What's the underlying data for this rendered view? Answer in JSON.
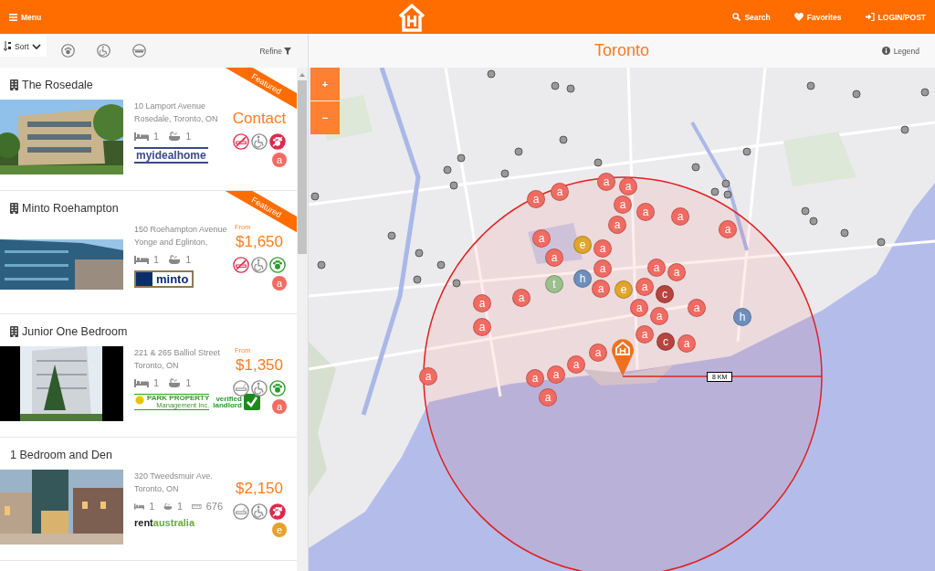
{
  "header": {
    "menu": "Menu",
    "nav": [
      "Search",
      "Favorites",
      "LOGIN/POST"
    ]
  },
  "toolbar": {
    "sort": "Sort",
    "refine": "Refine"
  },
  "listings": [
    {
      "title": "The Rosedale",
      "building_icon": true,
      "featured": true,
      "featured_label": "Featured",
      "address": [
        "10 Lamport Avenue",
        "Rosedale, Toronto, ON"
      ],
      "price": "Contact",
      "beds": "1",
      "baths": "1",
      "logo": {
        "kind": "myidealhome",
        "texts": [
          "myidealhome"
        ]
      },
      "amenities": [
        {
          "kind": "smoking",
          "crossed": true,
          "checked": false
        },
        {
          "kind": "wheelchair",
          "crossed": false,
          "checked": false
        },
        {
          "kind": "pets",
          "crossed": true,
          "checked": false
        }
      ],
      "marker": {
        "letter": "a",
        "color": "#f26b63"
      }
    },
    {
      "title": "Minto Roehampton",
      "building_icon": true,
      "featured": true,
      "featured_label": "Featured",
      "price_prefix": "From",
      "address": [
        "150 Roehampton Avenue",
        "Yonge and Eglinton,"
      ],
      "price": "$1,650",
      "beds": "1",
      "baths": "1",
      "logo": {
        "kind": "minto",
        "texts": [
          "minto"
        ]
      },
      "amenities": [
        {
          "kind": "smoking",
          "crossed": true,
          "checked": false
        },
        {
          "kind": "wheelchair",
          "crossed": false,
          "checked": false
        },
        {
          "kind": "pets",
          "crossed": false,
          "checked": true
        }
      ],
      "marker": {
        "letter": "a",
        "color": "#f26b63"
      }
    },
    {
      "title": "Junior One Bedroom",
      "building_icon": true,
      "featured": false,
      "price_prefix": "From",
      "address": [
        "221 & 265 Balliol Street",
        "Toronto, ON"
      ],
      "price": "$1,350",
      "beds": "1",
      "baths": "1",
      "logo": {
        "kind": "park",
        "texts": [
          "PARK PROPERTY",
          "Management Inc."
        ]
      },
      "verified": {
        "texts": [
          "verified",
          "landlord"
        ]
      },
      "amenities": [
        {
          "kind": "smoking",
          "crossed": false,
          "checked": false
        },
        {
          "kind": "wheelchair",
          "crossed": false,
          "checked": false
        },
        {
          "kind": "pets",
          "crossed": false,
          "checked": true
        }
      ],
      "marker": {
        "letter": "a",
        "color": "#f26b63"
      }
    },
    {
      "title": "1 Bedroom and Den",
      "building_icon": false,
      "featured": false,
      "address": [
        "320 Tweedsmuir Ave.",
        "Toronto, ON"
      ],
      "price": "$2,150",
      "beds": "1",
      "baths": "1",
      "area": "676",
      "logo": {
        "kind": "rentaustralia",
        "texts": [
          "rent",
          "australia"
        ]
      },
      "amenities": [
        {
          "kind": "smoking",
          "crossed": false,
          "checked": false
        },
        {
          "kind": "wheelchair",
          "crossed": false,
          "checked": false
        },
        {
          "kind": "pets",
          "crossed": true,
          "checked": false
        }
      ],
      "marker": {
        "letter": "e",
        "color": "#e6a22a"
      }
    }
  ],
  "map": {
    "title": "Toronto",
    "legend": "Legend",
    "zoom_in": "+",
    "zoom_out": "−",
    "radius_label": "8 KM",
    "markers": [
      {
        "letter": "a",
        "color": "#f26b63"
      },
      {
        "letter": "a",
        "color": "#f26b63"
      },
      {
        "letter": "a",
        "color": "#f26b63"
      },
      {
        "letter": "a",
        "color": "#f26b63"
      },
      {
        "letter": "a",
        "color": "#f26b63"
      },
      {
        "letter": "a",
        "color": "#f26b63"
      },
      {
        "letter": "a",
        "color": "#f26b63"
      },
      {
        "letter": "a",
        "color": "#f26b63"
      },
      {
        "letter": "a",
        "color": "#f26b63"
      },
      {
        "letter": "a",
        "color": "#f26b63"
      },
      {
        "letter": "e",
        "color": "#e0a52c"
      },
      {
        "letter": "a",
        "color": "#f26b63"
      },
      {
        "letter": "a",
        "color": "#f26b63"
      },
      {
        "letter": "a",
        "color": "#f26b63"
      },
      {
        "letter": "a",
        "color": "#f26b63"
      },
      {
        "letter": "a",
        "color": "#f26b63"
      },
      {
        "letter": "h",
        "color": "#6e8fbc"
      },
      {
        "letter": "t",
        "color": "#9cbf8e"
      },
      {
        "letter": "a",
        "color": "#f26b63"
      },
      {
        "letter": "e",
        "color": "#e0a52c"
      },
      {
        "letter": "a",
        "color": "#f26b63"
      },
      {
        "letter": "c",
        "color": "#b5453e"
      },
      {
        "letter": "a",
        "color": "#f26b63"
      },
      {
        "letter": "a",
        "color": "#f26b63"
      },
      {
        "letter": "a",
        "color": "#f26b63"
      },
      {
        "letter": "a",
        "color": "#f26b63"
      },
      {
        "letter": "a",
        "color": "#f26b63"
      },
      {
        "letter": "h",
        "color": "#6e8fbc"
      },
      {
        "letter": "a",
        "color": "#f26b63"
      },
      {
        "letter": "a",
        "color": "#f26b63"
      },
      {
        "letter": "c",
        "color": "#b5453e"
      },
      {
        "letter": "a",
        "color": "#f26b63"
      },
      {
        "letter": "a",
        "color": "#f26b63"
      },
      {
        "letter": "a",
        "color": "#f26b63"
      },
      {
        "letter": "a",
        "color": "#f26b63"
      },
      {
        "letter": "a",
        "color": "#f26b63"
      },
      {
        "letter": "a",
        "color": "#f26b63"
      },
      {
        "letter": "a",
        "color": "#f26b63"
      }
    ]
  }
}
